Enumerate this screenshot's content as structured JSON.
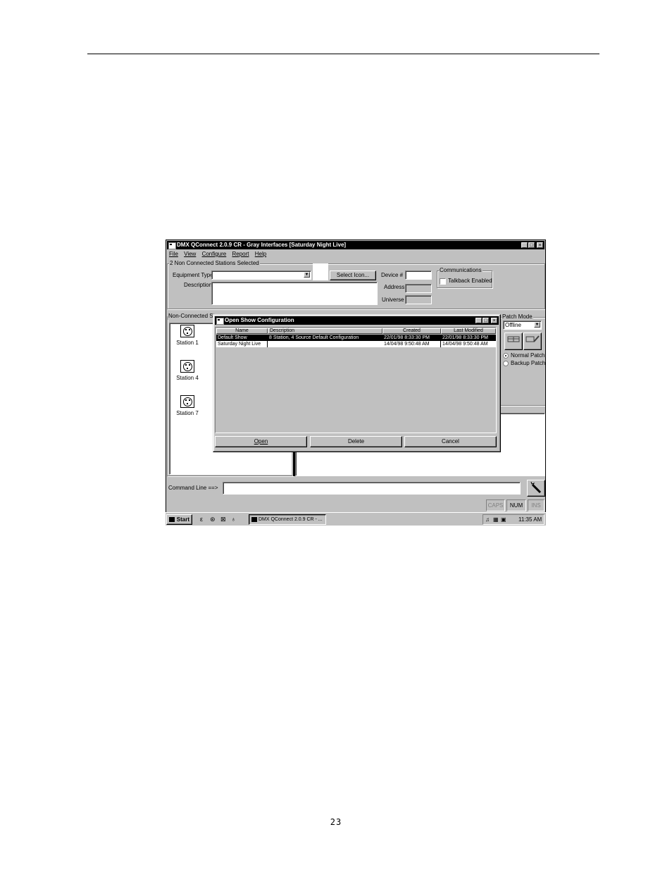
{
  "page_number": "23",
  "window": {
    "title": "DMX QConnect 2.0.9 CR - Gray Interfaces [Saturday Night Live]",
    "min_btn": "_",
    "max_btn": "□",
    "close_btn": "×"
  },
  "menu": [
    "File",
    "View",
    "Configure",
    "Report",
    "Help"
  ],
  "selection_group": {
    "title": "2 Non Connected Stations Selected",
    "equipment_type_label": "Equipment Type",
    "equipment_type_value": "",
    "description_label": "Description",
    "description_value": "",
    "select_icon_button": "Select Icon...",
    "device_label": "Device #",
    "device_value": "",
    "address_label": "Address",
    "universe_label": "Universe"
  },
  "communications": {
    "title": "Communications",
    "talkback_label": "Talkback Enabled",
    "talkback_checked": false
  },
  "non_connected": {
    "title": "Non-Connected St",
    "stations": [
      "Station 1",
      "Station 4",
      "Station 7"
    ]
  },
  "patch_mode": {
    "title": "Patch Mode",
    "value": "Offline",
    "normal_label": "Normal Patch",
    "backup_label": "Backup Patch",
    "selected": "Normal Patch"
  },
  "dialog": {
    "title": "Open Show Configuration",
    "columns": [
      "Name",
      "Description",
      "Created",
      "Last Modified"
    ],
    "rows": [
      {
        "name": "Default Show",
        "description": "8 Station, 4 Source Default Configuration",
        "created": "22/01/98 8:33:30 PM",
        "modified": "22/01/98 8:33:30 PM",
        "selected": true
      },
      {
        "name": "Saturday Night Live",
        "description": "",
        "created": "14/04/98 9:50:48 AM",
        "modified": "14/04/98 9:50:48 AM",
        "selected": false
      }
    ],
    "open_button": "Open",
    "delete_button": "Delete",
    "cancel_button": "Cancel"
  },
  "command_line": {
    "label": "Command Line ==>",
    "value": ""
  },
  "statusbar": {
    "caps": "CAPS",
    "num": "NUM",
    "ins": "INS"
  },
  "taskbar": {
    "start": "Start",
    "task": "DMX QConnect 2.0.9 CR - ...",
    "clock": "11:35 AM"
  }
}
